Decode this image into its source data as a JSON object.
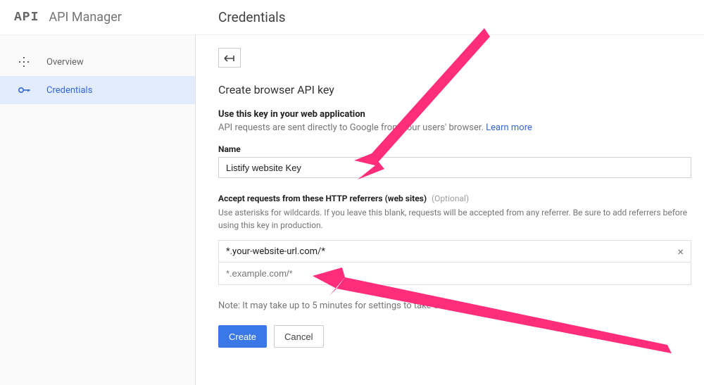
{
  "header": {
    "logo": "API",
    "app_name": "API Manager",
    "page_title": "Credentials"
  },
  "sidebar": {
    "items": [
      {
        "label": "Overview",
        "icon": "overview"
      },
      {
        "label": "Credentials",
        "icon": "key"
      }
    ]
  },
  "main": {
    "section_title": "Create browser API key",
    "use_key_heading": "Use this key in your web application",
    "use_key_desc_prefix": "API requests are sent directly to Google from your users' browser. ",
    "learn_more": "Learn more",
    "name_label": "Name",
    "name_value": "Listify website Key",
    "referrers_label": "Accept requests from these HTTP referrers (web sites)",
    "referrers_optional": "(Optional)",
    "referrers_help": "Use asterisks for wildcards. If you leave this blank, requests will be accepted from any referrer. Be sure to add referrers before using this key in production.",
    "referrer_value": "*.your-website-url.com/*",
    "referrer_placeholder": "*.example.com/*",
    "note": "Note: It may take up to 5 minutes for settings to take effect",
    "create_label": "Create",
    "cancel_label": "Cancel"
  },
  "annotations": {
    "arrow_color": "#ff2d7a"
  }
}
